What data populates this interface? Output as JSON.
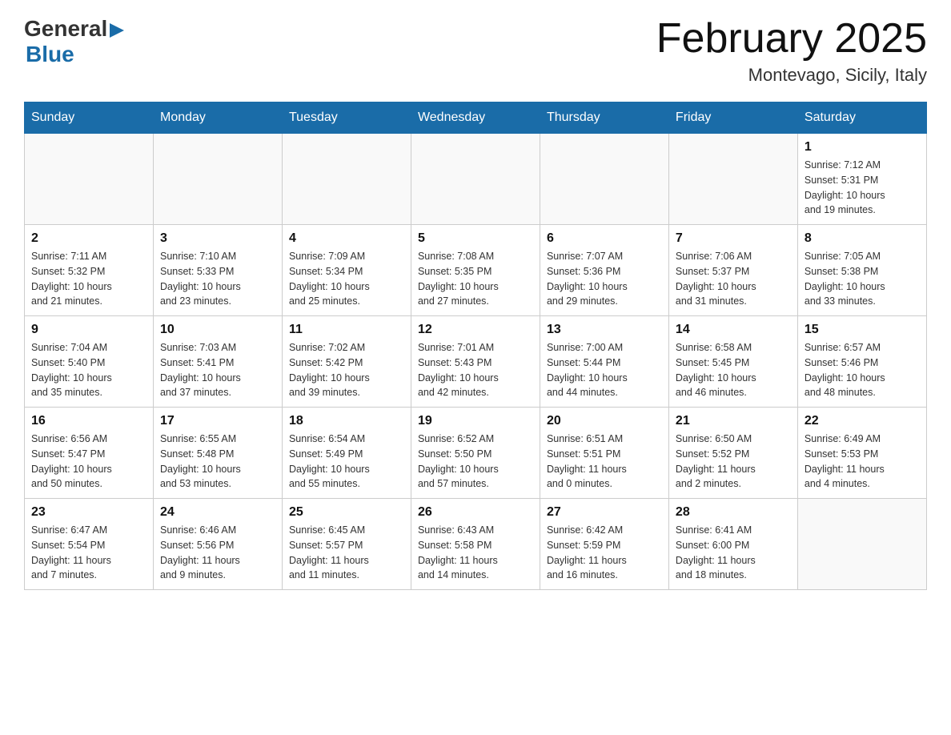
{
  "header": {
    "logo_general": "General",
    "logo_blue": "Blue",
    "month_title": "February 2025",
    "location": "Montevago, Sicily, Italy"
  },
  "weekdays": [
    "Sunday",
    "Monday",
    "Tuesday",
    "Wednesday",
    "Thursday",
    "Friday",
    "Saturday"
  ],
  "weeks": [
    [
      {
        "day": "",
        "info": ""
      },
      {
        "day": "",
        "info": ""
      },
      {
        "day": "",
        "info": ""
      },
      {
        "day": "",
        "info": ""
      },
      {
        "day": "",
        "info": ""
      },
      {
        "day": "",
        "info": ""
      },
      {
        "day": "1",
        "info": "Sunrise: 7:12 AM\nSunset: 5:31 PM\nDaylight: 10 hours\nand 19 minutes."
      }
    ],
    [
      {
        "day": "2",
        "info": "Sunrise: 7:11 AM\nSunset: 5:32 PM\nDaylight: 10 hours\nand 21 minutes."
      },
      {
        "day": "3",
        "info": "Sunrise: 7:10 AM\nSunset: 5:33 PM\nDaylight: 10 hours\nand 23 minutes."
      },
      {
        "day": "4",
        "info": "Sunrise: 7:09 AM\nSunset: 5:34 PM\nDaylight: 10 hours\nand 25 minutes."
      },
      {
        "day": "5",
        "info": "Sunrise: 7:08 AM\nSunset: 5:35 PM\nDaylight: 10 hours\nand 27 minutes."
      },
      {
        "day": "6",
        "info": "Sunrise: 7:07 AM\nSunset: 5:36 PM\nDaylight: 10 hours\nand 29 minutes."
      },
      {
        "day": "7",
        "info": "Sunrise: 7:06 AM\nSunset: 5:37 PM\nDaylight: 10 hours\nand 31 minutes."
      },
      {
        "day": "8",
        "info": "Sunrise: 7:05 AM\nSunset: 5:38 PM\nDaylight: 10 hours\nand 33 minutes."
      }
    ],
    [
      {
        "day": "9",
        "info": "Sunrise: 7:04 AM\nSunset: 5:40 PM\nDaylight: 10 hours\nand 35 minutes."
      },
      {
        "day": "10",
        "info": "Sunrise: 7:03 AM\nSunset: 5:41 PM\nDaylight: 10 hours\nand 37 minutes."
      },
      {
        "day": "11",
        "info": "Sunrise: 7:02 AM\nSunset: 5:42 PM\nDaylight: 10 hours\nand 39 minutes."
      },
      {
        "day": "12",
        "info": "Sunrise: 7:01 AM\nSunset: 5:43 PM\nDaylight: 10 hours\nand 42 minutes."
      },
      {
        "day": "13",
        "info": "Sunrise: 7:00 AM\nSunset: 5:44 PM\nDaylight: 10 hours\nand 44 minutes."
      },
      {
        "day": "14",
        "info": "Sunrise: 6:58 AM\nSunset: 5:45 PM\nDaylight: 10 hours\nand 46 minutes."
      },
      {
        "day": "15",
        "info": "Sunrise: 6:57 AM\nSunset: 5:46 PM\nDaylight: 10 hours\nand 48 minutes."
      }
    ],
    [
      {
        "day": "16",
        "info": "Sunrise: 6:56 AM\nSunset: 5:47 PM\nDaylight: 10 hours\nand 50 minutes."
      },
      {
        "day": "17",
        "info": "Sunrise: 6:55 AM\nSunset: 5:48 PM\nDaylight: 10 hours\nand 53 minutes."
      },
      {
        "day": "18",
        "info": "Sunrise: 6:54 AM\nSunset: 5:49 PM\nDaylight: 10 hours\nand 55 minutes."
      },
      {
        "day": "19",
        "info": "Sunrise: 6:52 AM\nSunset: 5:50 PM\nDaylight: 10 hours\nand 57 minutes."
      },
      {
        "day": "20",
        "info": "Sunrise: 6:51 AM\nSunset: 5:51 PM\nDaylight: 11 hours\nand 0 minutes."
      },
      {
        "day": "21",
        "info": "Sunrise: 6:50 AM\nSunset: 5:52 PM\nDaylight: 11 hours\nand 2 minutes."
      },
      {
        "day": "22",
        "info": "Sunrise: 6:49 AM\nSunset: 5:53 PM\nDaylight: 11 hours\nand 4 minutes."
      }
    ],
    [
      {
        "day": "23",
        "info": "Sunrise: 6:47 AM\nSunset: 5:54 PM\nDaylight: 11 hours\nand 7 minutes."
      },
      {
        "day": "24",
        "info": "Sunrise: 6:46 AM\nSunset: 5:56 PM\nDaylight: 11 hours\nand 9 minutes."
      },
      {
        "day": "25",
        "info": "Sunrise: 6:45 AM\nSunset: 5:57 PM\nDaylight: 11 hours\nand 11 minutes."
      },
      {
        "day": "26",
        "info": "Sunrise: 6:43 AM\nSunset: 5:58 PM\nDaylight: 11 hours\nand 14 minutes."
      },
      {
        "day": "27",
        "info": "Sunrise: 6:42 AM\nSunset: 5:59 PM\nDaylight: 11 hours\nand 16 minutes."
      },
      {
        "day": "28",
        "info": "Sunrise: 6:41 AM\nSunset: 6:00 PM\nDaylight: 11 hours\nand 18 minutes."
      },
      {
        "day": "",
        "info": ""
      }
    ]
  ]
}
